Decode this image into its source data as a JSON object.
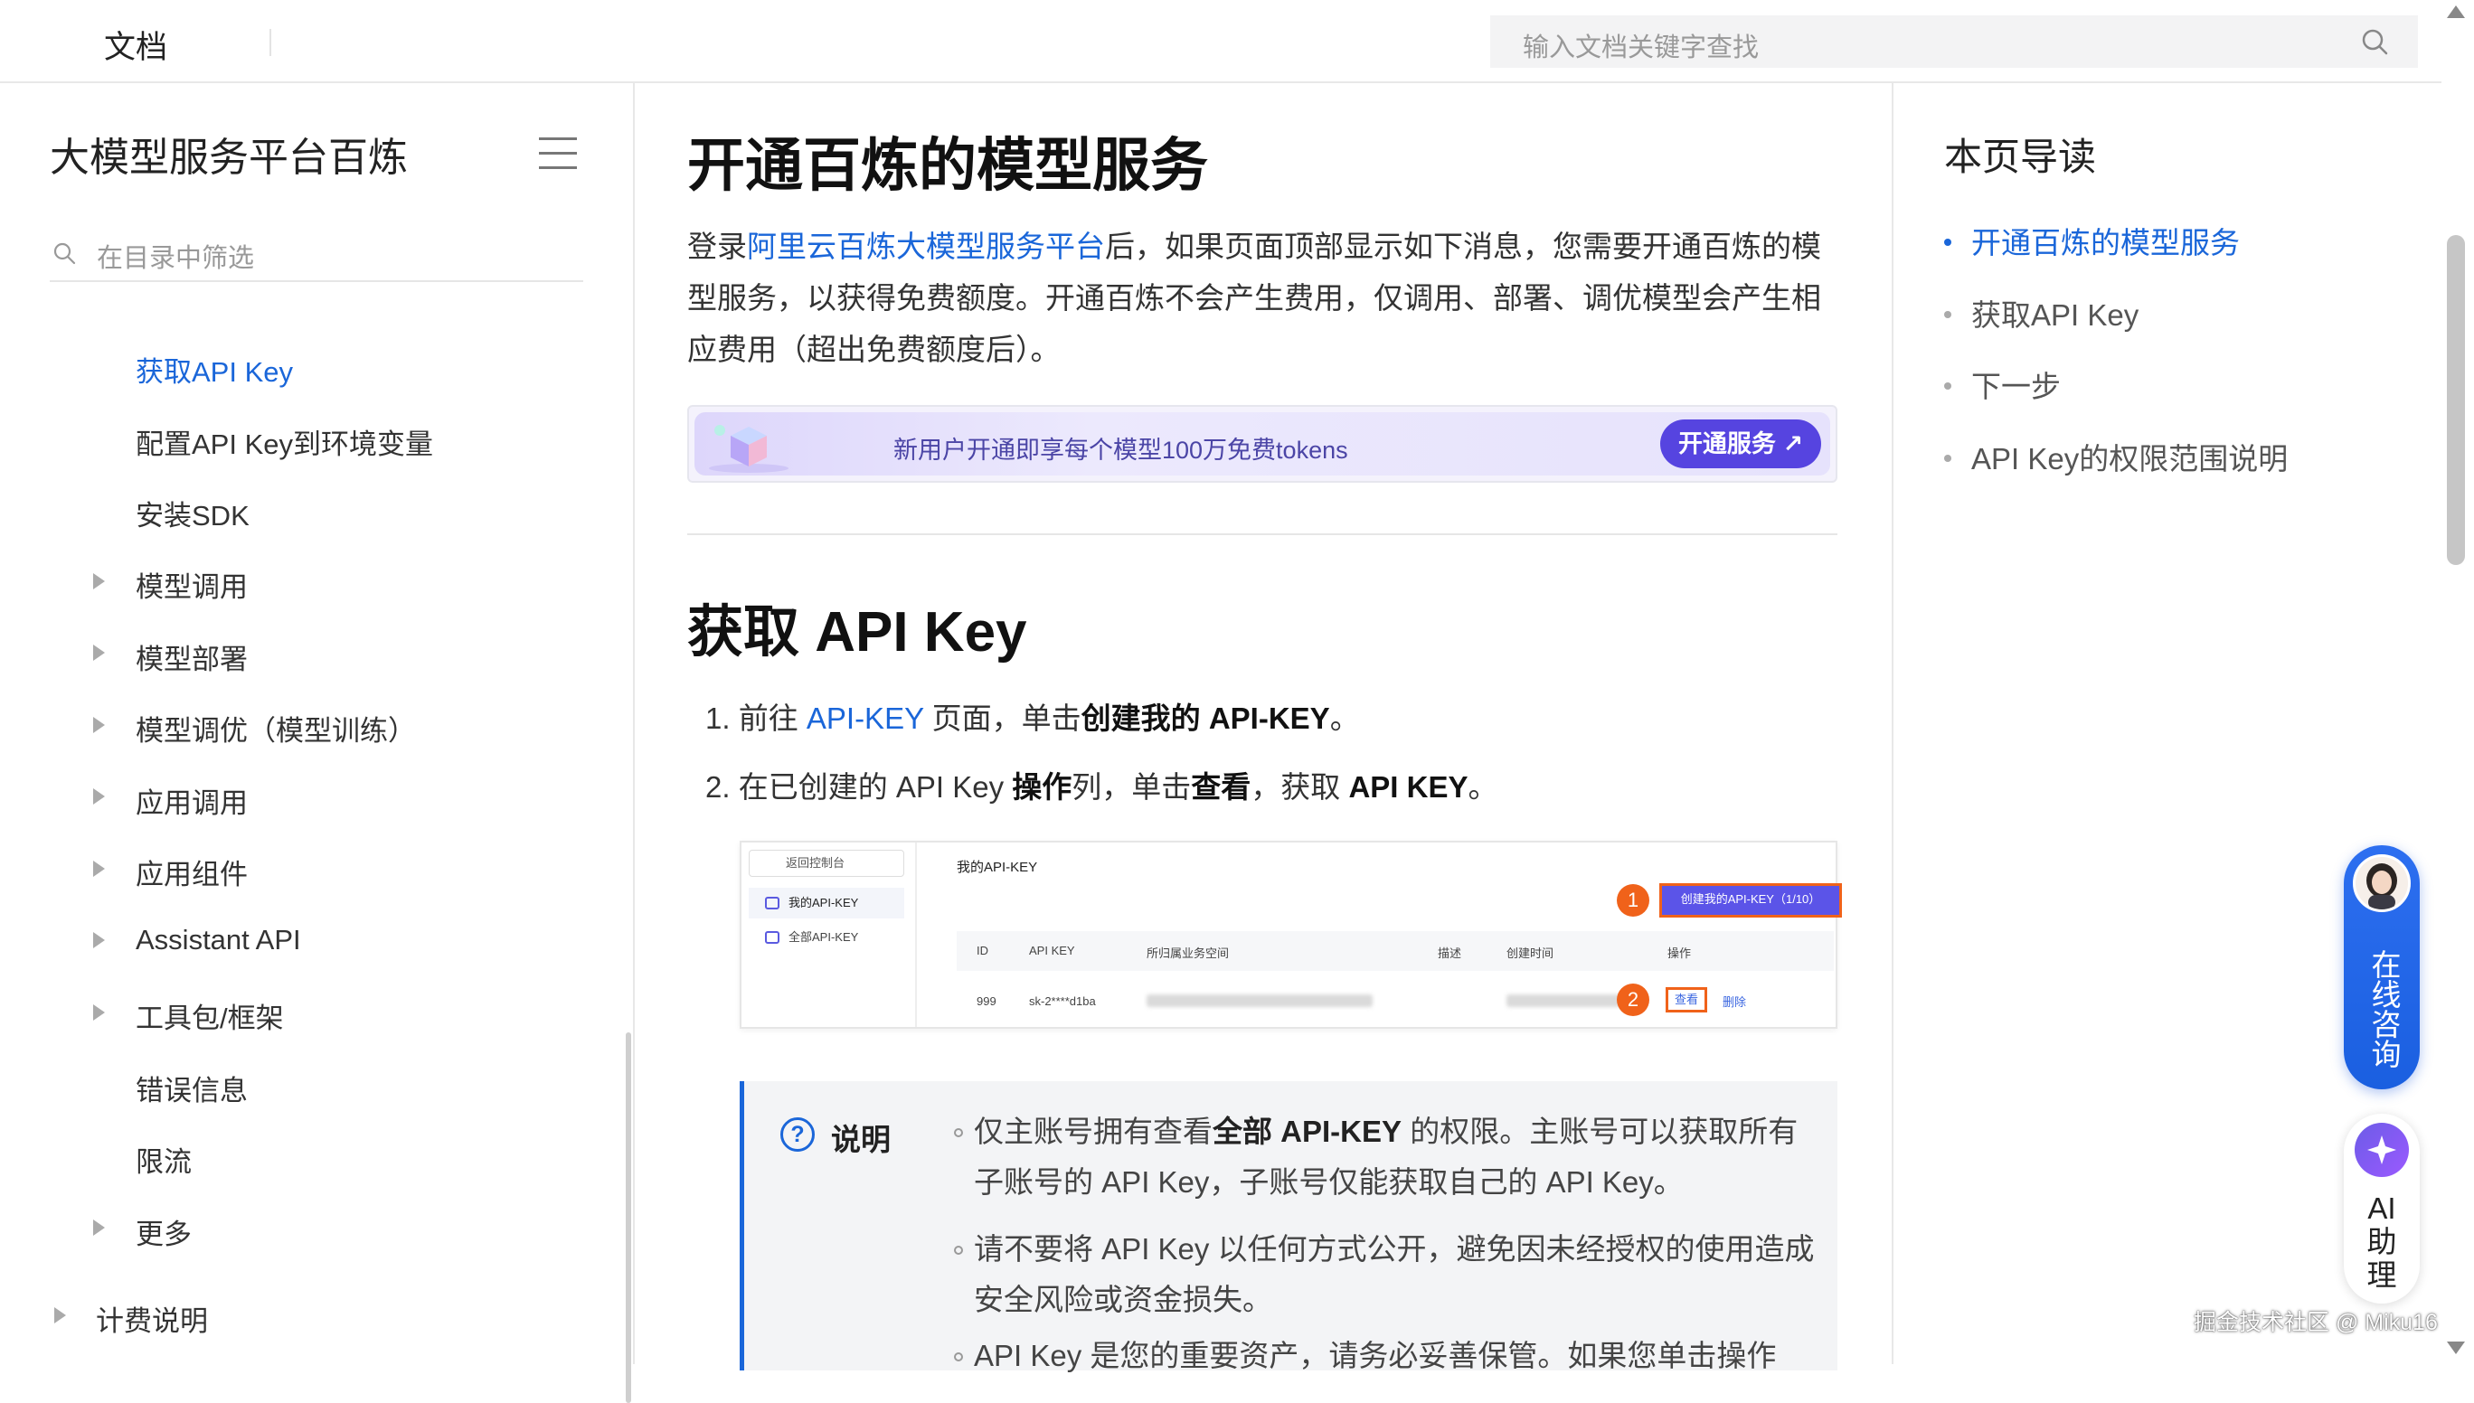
{
  "topbar": {
    "title": "文档",
    "search_placeholder": "输入文档关键字查找"
  },
  "sidebar": {
    "title": "大模型服务平台百炼",
    "filter_placeholder": "在目录中筛选",
    "items": [
      {
        "label": "获取API Key",
        "active": true,
        "expandable": false
      },
      {
        "label": "配置API Key到环境变量",
        "active": false,
        "expandable": false
      },
      {
        "label": "安装SDK",
        "active": false,
        "expandable": false
      },
      {
        "label": "模型调用",
        "active": false,
        "expandable": true
      },
      {
        "label": "模型部署",
        "active": false,
        "expandable": true
      },
      {
        "label": "模型调优（模型训练）",
        "active": false,
        "expandable": true
      },
      {
        "label": "应用调用",
        "active": false,
        "expandable": true
      },
      {
        "label": "应用组件",
        "active": false,
        "expandable": true
      },
      {
        "label": "Assistant API",
        "active": false,
        "expandable": true
      },
      {
        "label": "工具包/框架",
        "active": false,
        "expandable": true
      },
      {
        "label": "错误信息",
        "active": false,
        "expandable": false
      },
      {
        "label": "限流",
        "active": false,
        "expandable": false
      },
      {
        "label": "更多",
        "active": false,
        "expandable": true
      },
      {
        "label": "计费说明",
        "active": false,
        "expandable": true
      }
    ]
  },
  "main": {
    "page_title": "开通百炼的模型服务",
    "intro": {
      "prefix": "登录",
      "link": "阿里云百炼大模型服务平台",
      "suffix": "后，如果页面顶部显示如下消息，您需要开通百炼的模型服务，以获得免费额度。开通百炼不会产生费用，仅调用、部署、调优模型会产生相应费用（超出免费额度后）。"
    },
    "banner": {
      "text": "新用户开通即享每个模型100万免费tokens",
      "button": "开通服务 ↗"
    },
    "section_title": "获取 API Key",
    "steps": [
      {
        "num": "1.",
        "pre": "前往 ",
        "link": "API-KEY",
        "mid": " 页面，单击",
        "bold": "创建我的 API-KEY",
        "post": "。"
      },
      {
        "num": "2.",
        "pre": "在已创建的 API Key ",
        "bold1": "操作",
        "mid": "列，单击",
        "bold2": "查看",
        "mid2": "，获取 ",
        "bold3": "API KEY",
        "post": "。"
      }
    ],
    "screenshot": {
      "back": "返回控制台",
      "menu_my": "我的API-KEY",
      "menu_all": "全部API-KEY",
      "title": "我的API-KEY",
      "create_btn": "创建我的API-KEY（1/10）",
      "badge1": "1",
      "badge2": "2",
      "columns": [
        "ID",
        "API KEY",
        "所归属业务空间",
        "描述",
        "创建时间",
        "操作"
      ],
      "row": {
        "id": "999",
        "key": "sk-2****d1ba",
        "view": "查看",
        "delete": "删除"
      }
    },
    "note": {
      "title": "说明",
      "items": [
        {
          "pre": "仅主账号拥有查看",
          "bold": "全部 API-KEY",
          "post": " 的权限。主账号可以获取所有子账号的 API Key，子账号仅能获取自己的 API Key。"
        },
        {
          "text": "请不要将 API Key 以任何方式公开，避免因未经授权的使用造成安全风险或资金损失。"
        },
        {
          "text": "API Key 是您的重要资产，请务必妥善保管。如果您单击操作"
        }
      ]
    }
  },
  "toc": {
    "title": "本页导读",
    "items": [
      {
        "label": "开通百炼的模型服务",
        "active": true
      },
      {
        "label": "获取API Key",
        "active": false
      },
      {
        "label": "下一步",
        "active": false
      },
      {
        "label": "API Key的权限范围说明",
        "active": false
      }
    ]
  },
  "floating": {
    "consult": "在线咨询",
    "ai_help": "AI助理"
  },
  "watermark": "掘金技术社区 @ Miku16",
  "colors": {
    "accent": "#1a66d9",
    "banner_button": "#5644e0",
    "highlight": "#f0621a"
  }
}
